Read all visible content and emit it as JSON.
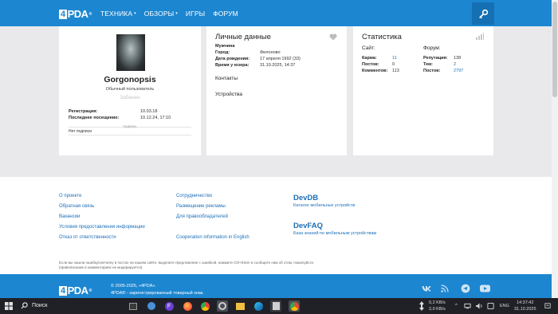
{
  "nav": {
    "logo": "PDA",
    "logo_prefix": "4",
    "logo_reg": "®",
    "items": [
      {
        "label": "ТЕХНИКА",
        "dropdown": true
      },
      {
        "label": "ОБЗОРЫ",
        "dropdown": true
      },
      {
        "label": "ИГРЫ",
        "dropdown": false
      },
      {
        "label": "ФОРУМ",
        "dropdown": false
      }
    ],
    "login_icon": "key-icon"
  },
  "profile": {
    "username": "Gorgonopsis",
    "group": "Обычный пользователь",
    "status": "Забанен",
    "registration_label": "Регистрация:",
    "registration_value": "10.03.18",
    "last_visit_label": "Последнее посещение:",
    "last_visit_value": "10.12.24, 17:10",
    "signature_label": "подпись",
    "signature_value": "Нет подписи"
  },
  "personal": {
    "title": "Личные данные",
    "gender": "Мужчина",
    "city_label": "Город:",
    "city_value": "Филоново",
    "birthday_label": "Дата рождения:",
    "birthday_value": "17 апреля 1992 (33)",
    "usertime_label": "Время у юзера:",
    "usertime_value": "31.10.2025, 14:37",
    "contacts": "Контакты",
    "devices": "Устройства",
    "favorite_icon": "heart-icon"
  },
  "stats": {
    "title": "Статистика",
    "site_label": "Сайт:",
    "forum_label": "Форум:",
    "site": [
      {
        "label": "Карма:",
        "value": "11",
        "link": true
      },
      {
        "label": "Постов:",
        "value": "0",
        "link": false
      },
      {
        "label": "Комментов:",
        "value": "113",
        "link": false
      }
    ],
    "forum": [
      {
        "label": "Репутация:",
        "value": "138",
        "link": false
      },
      {
        "label": "Тем:",
        "value": "2",
        "link": true
      },
      {
        "label": "Постов:",
        "value": "2797",
        "link": true
      }
    ],
    "chart_icon": "bar-chart-icon"
  },
  "footer": {
    "col1": [
      "О проекте",
      "Обратная связь",
      "Вакансии",
      "Условия предоставления информации",
      "Отказ от ответственности"
    ],
    "col2": [
      "Сотрудничество",
      "Размещение рекламы",
      "Для правообладателей",
      "Cooperation information in English"
    ],
    "devdb_title": "DevDB",
    "devdb_desc": "Каталог мобильных устройств",
    "devfaq_title": "DevFAQ",
    "devfaq_desc": "База знаний по мобильным устройствам",
    "note_line1": "Если вы нашли ошибку/опечатку в постах на нашем сайте, выделите предложение с ошибкой, нажмите Ctrl+Enter и сообщите нам об этом, пожалуйста",
    "note_line2": "(правописание в комментариях не модерируется)."
  },
  "bottombar": {
    "copyright": "© 2005-2025, «4PDA».",
    "trademark": "4PDA® - зарегистрированный товарный знак.",
    "social": [
      "vk-icon",
      "rss-icon",
      "telegram-icon",
      "youtube-icon"
    ]
  },
  "taskbar": {
    "search": "Поиск",
    "net_up": "0,2 KB/s",
    "net_down": "2,0 KB/s",
    "lang": "ENG",
    "time": "14:37:42",
    "date": "31.10.2025"
  },
  "colors": {
    "brand_blue": "#1c86d0",
    "link_blue": "#1c6fb8"
  }
}
